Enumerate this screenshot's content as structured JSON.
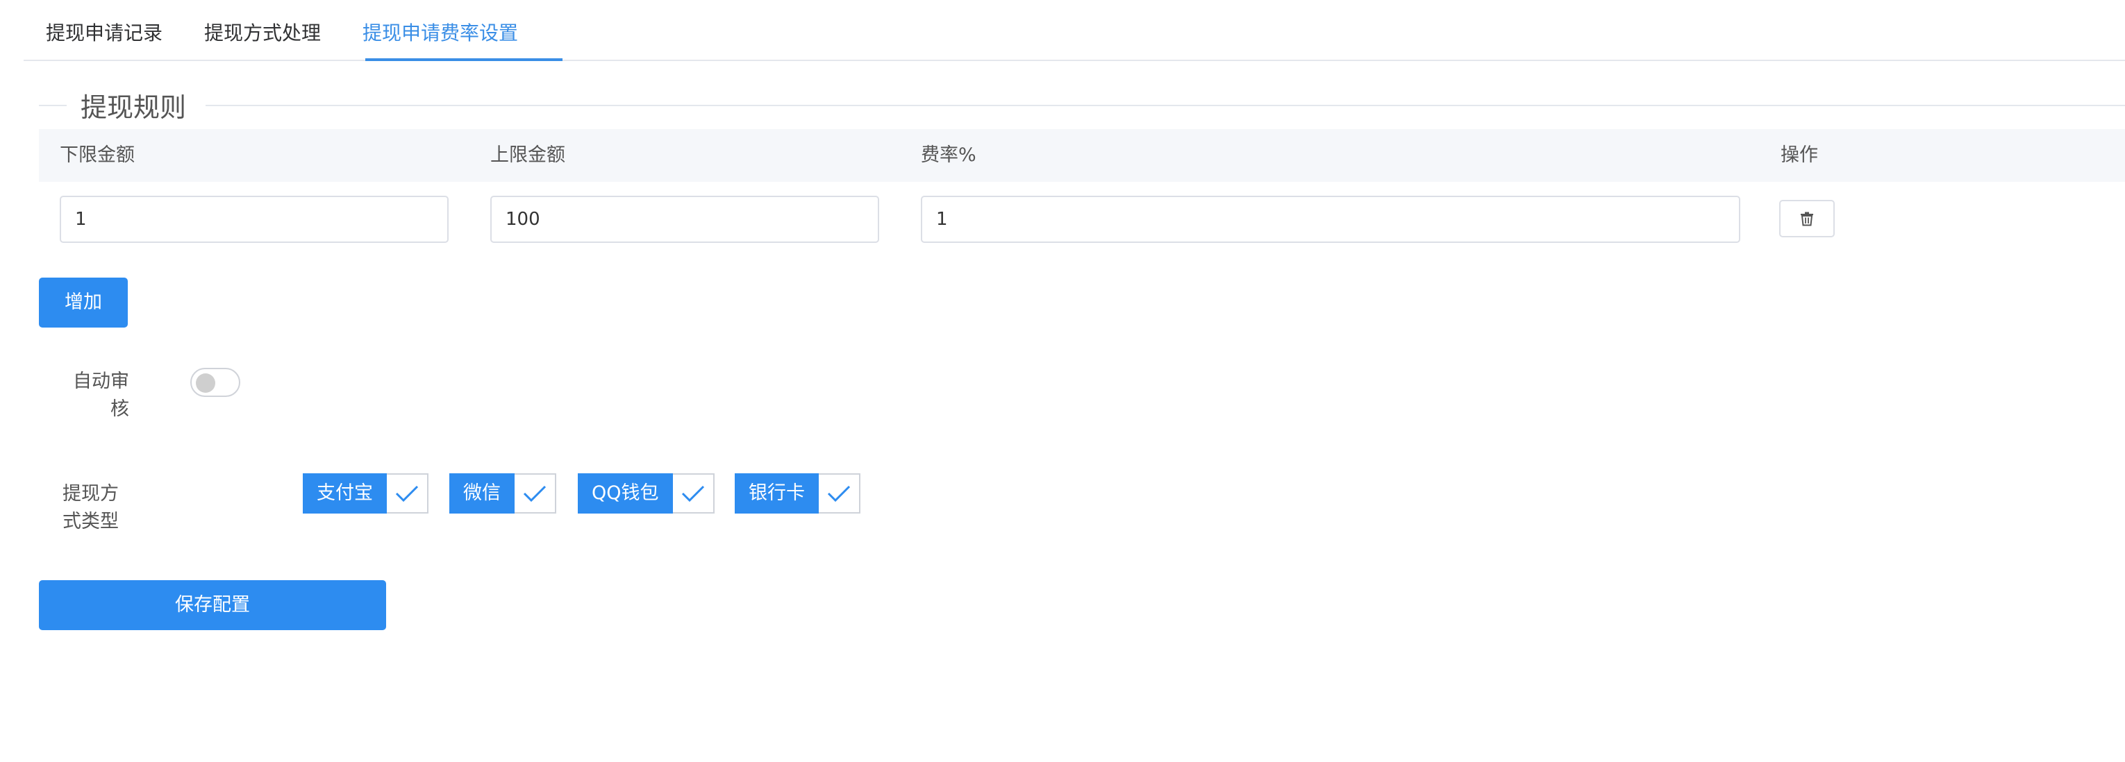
{
  "tabs": [
    {
      "label": "提现申请记录",
      "active": false
    },
    {
      "label": "提现方式处理",
      "active": false
    },
    {
      "label": "提现申请费率设置",
      "active": true
    }
  ],
  "rules": {
    "legend": "提现规则",
    "headers": {
      "min": "下限金额",
      "max": "上限金额",
      "rate": "费率%",
      "action": "操作"
    },
    "rows": [
      {
        "min": "1",
        "max": "100",
        "rate": "1"
      }
    ],
    "add_label": "增加"
  },
  "auto_review": {
    "label": "自动审核",
    "enabled": false
  },
  "withdraw_types": {
    "label": "提现方式类型",
    "options": [
      {
        "label": "支付宝",
        "checked": true
      },
      {
        "label": "微信",
        "checked": true
      },
      {
        "label": "QQ钱包",
        "checked": true
      },
      {
        "label": "银行卡",
        "checked": true
      }
    ]
  },
  "save_label": "保存配置",
  "colors": {
    "primary": "#2d8cf0",
    "tab_active": "#3a8ee6",
    "header_bg": "#f5f7fa"
  },
  "icons": {
    "delete": "trash-icon",
    "check": "check-icon"
  }
}
